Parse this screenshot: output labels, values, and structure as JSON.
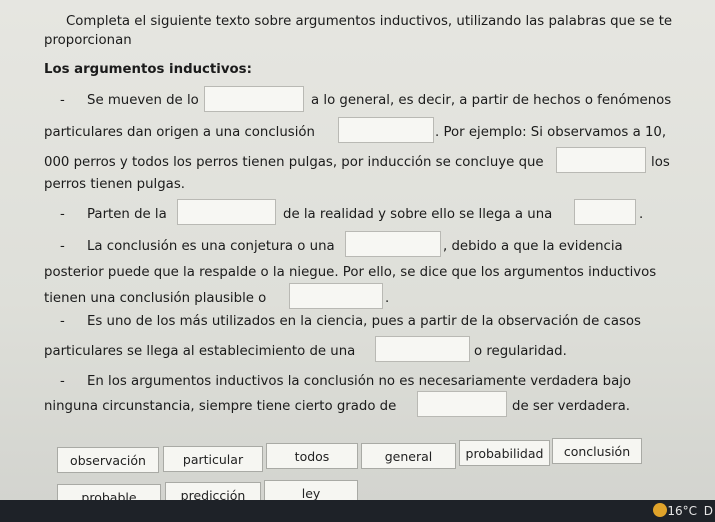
{
  "instructions": {
    "line1": "Completa el siguiente texto sobre argumentos inductivos, utilizando las palabras que se te",
    "line2": "proporcionan"
  },
  "heading": "Los argumentos inductivos:",
  "items": {
    "i1_a": "Se mueven de lo",
    "i1_b": "a lo general, es decir, a partir de hechos o fenómenos",
    "i1_c": "particulares dan origen a una conclusión",
    "i1_d": ". Por ejemplo: Si observamos a 10,",
    "i1_e": "000 perros y todos los perros tienen pulgas, por inducción se concluye que",
    "i1_f": "los",
    "i1_g": "perros tienen pulgas.",
    "i2_a": "Parten de la",
    "i2_b": "de la realidad y sobre ello se llega a una",
    "i2_c": ".",
    "i3_a": "La conclusión es una conjetura o una",
    "i3_b": ", debido a que la evidencia",
    "i3_c": "posterior puede que la respalde o la niegue. Por ello, se dice que los  argumentos inductivos",
    "i3_d": "tienen una conclusión plausible o",
    "i3_e": ".",
    "i4_a": "Es uno de los más utilizados en la ciencia, pues a partir de la observación de  casos",
    "i4_b": "particulares se llega al establecimiento de una",
    "i4_c": "o regularidad.",
    "i5_a": "En los argumentos inductivos la conclusión no es necesariamente verdadera bajo",
    "i5_b": "ninguna circunstancia, siempre tiene cierto grado de",
    "i5_c": "de ser verdadera.",
    "dash": "-"
  },
  "word_bank": {
    "row1": [
      "observación",
      "particular",
      "todos",
      "general",
      "probabilidad",
      "conclusión"
    ],
    "row2": [
      "probable",
      "predicción",
      "ley"
    ]
  },
  "taskbar": {
    "temperature": "16°C",
    "trailing": "D"
  }
}
